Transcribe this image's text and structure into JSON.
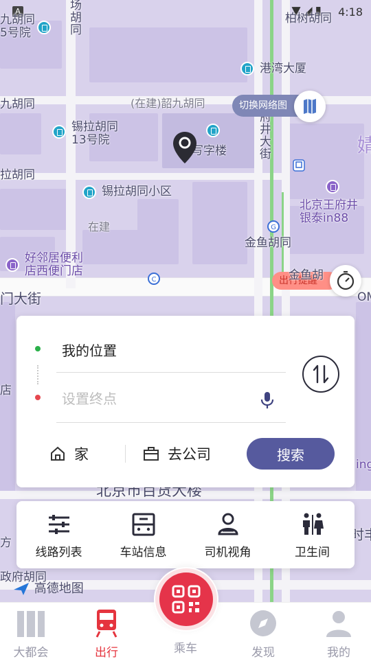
{
  "status_bar": {
    "time": "4:18",
    "notification_badge": "A"
  },
  "map": {
    "switch_label": "切换网络图",
    "traffic_badge": "出行提醒",
    "brand": "高德地图",
    "labels": {
      "bocai": "柏树胡同",
      "jiuhutong": "九胡同\n5号院",
      "jiuhutong2": "九胡同",
      "yangfang": "场\n胡\n同",
      "gangwan": "港湾大厦",
      "shaojiu": "(在建)韶九胡同",
      "xila13": "锡拉胡同\n13号院",
      "xiezi": "工写字楼",
      "wangfujing_v": "府\n井\n大\n街",
      "lahutong": "拉胡同",
      "xila_xiaoqu": "锡拉胡同小区",
      "wangfujing_mall": "北京王府井\n银泰in88",
      "zaijian": "在建",
      "jinyu": "金鱼胡同",
      "jinyu2": "金鱼胡",
      "haolinju": "好邻居便利\n店西便门店",
      "damen": "门大街",
      "dian": "店",
      "baihuo": "北京市百货大楼",
      "fangjie": "方",
      "zhengfu": "政府胡同",
      "shijie": "时丰",
      "ing": "ing",
      "om": "OM",
      "jing": "婧"
    }
  },
  "route_card": {
    "origin": "我的位置",
    "destination_placeholder": "设置终点",
    "destination_value": "",
    "home_label": "家",
    "office_label": "去公司",
    "search_label": "搜索"
  },
  "features": [
    {
      "label": "线路列表",
      "icon": "sliders-icon"
    },
    {
      "label": "车站信息",
      "icon": "station-icon"
    },
    {
      "label": "司机视角",
      "icon": "driver-icon"
    },
    {
      "label": "卫生间",
      "icon": "restroom-icon"
    }
  ],
  "bottom_nav": {
    "items": [
      {
        "label": "大都会",
        "icon": "metro-logo-icon",
        "active": false
      },
      {
        "label": "出行",
        "icon": "train-icon",
        "active": true
      },
      {
        "label": "乘车",
        "icon": "qr-code-icon",
        "active": false
      },
      {
        "label": "发现",
        "icon": "compass-icon",
        "active": false
      },
      {
        "label": "我的",
        "icon": "user-icon",
        "active": false
      }
    ]
  },
  "colors": {
    "accent": "#565a9e",
    "active_nav": "#e5343e",
    "fab": "#e5344a",
    "map_block": "#ccc3e6",
    "metro_line": "#8bd487"
  }
}
